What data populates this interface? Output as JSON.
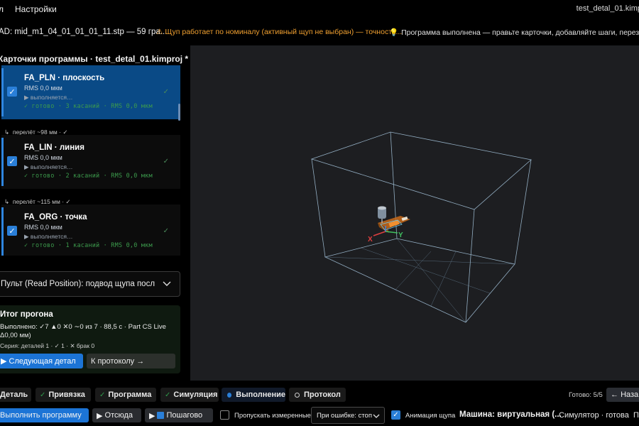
{
  "menu": {
    "items": [
      "л",
      "Настройки"
    ],
    "window_title": "test_detal_01.kimp"
  },
  "status": {
    "cad": "AD: mid_m1_04_01_01_01_11.stp — 59 гра...",
    "warning": "Щуп работает по номиналу (активный щуп не выбран) — точность...",
    "hint": "Программа выполнена — правьте карточки, добавляйте шаги, перезапускай..."
  },
  "cards_panel": {
    "title": "Карточки программы ·  test_detal_01.kimproj *",
    "cards": [
      {
        "name": "FA_PLN · плоскость",
        "rms": "RMS 0,0 мкм",
        "running": "выполняется…",
        "done": "готово · 3 касаний · RMS 0,0 мкм",
        "active": true
      },
      {
        "name": "FA_LIN · линия",
        "rms": "RMS 0,0 мкм",
        "running": "выполняется…",
        "done": "готово · 2 касаний · RMS 0,0 мкм",
        "active": false
      },
      {
        "name": "FA_ORG · точка",
        "rms": "RMS 0,0 мкм",
        "running": "выполняется…",
        "done": "готово · 1 касаний · RMS 0,0 мкм",
        "active": false
      }
    ],
    "transits": [
      "перелёт ~98 мм ·",
      "перелёт ~115 мм ·"
    ]
  },
  "pendant_dropdown": {
    "value": "Пульт (Read Position): подвод щупа посл"
  },
  "summary": {
    "title": "Итог прогона",
    "line1": "Выполнено: ✓7 ▲0 ✕0 ∼0 из 7 · 88,5 с · Part CS Live",
    "line2": "Δ0,00 мм)",
    "line3": "Серия: деталей 1 · ✓ 1 · ✕ брак 0",
    "next_button": "Следующая детал",
    "protocol_button": "К протоколу →"
  },
  "viewport": {
    "axis_x": "X",
    "axis_y": "Y"
  },
  "tabs": {
    "items": [
      {
        "label": "Деталь",
        "state": "plain"
      },
      {
        "label": "Привязка",
        "state": "done"
      },
      {
        "label": "Программа",
        "state": "done"
      },
      {
        "label": "Симуляция",
        "state": "done"
      },
      {
        "label": "Выполнение",
        "state": "current"
      },
      {
        "label": "Протокол",
        "state": "todo"
      }
    ],
    "done_count": "Готово: 5/5",
    "back_button": "Наза"
  },
  "toolbar": {
    "run_button": "Выполнить программу",
    "from_here_button": "Отсюда",
    "step_button": "Пошагово",
    "skip_measured_label": "Пропускать измеренные",
    "on_error_select": "При ошибке: стоп",
    "probe_animation_label": "Анимация щупа",
    "machine_label": "Машина: виртуальная (...",
    "simulator_status": "Симулятор · готова",
    "trailing": "П"
  },
  "colors": {
    "accent": "#1c74d6",
    "active_card": "#0a4a86",
    "warning": "#f0a030",
    "success": "#2f9a4a"
  }
}
